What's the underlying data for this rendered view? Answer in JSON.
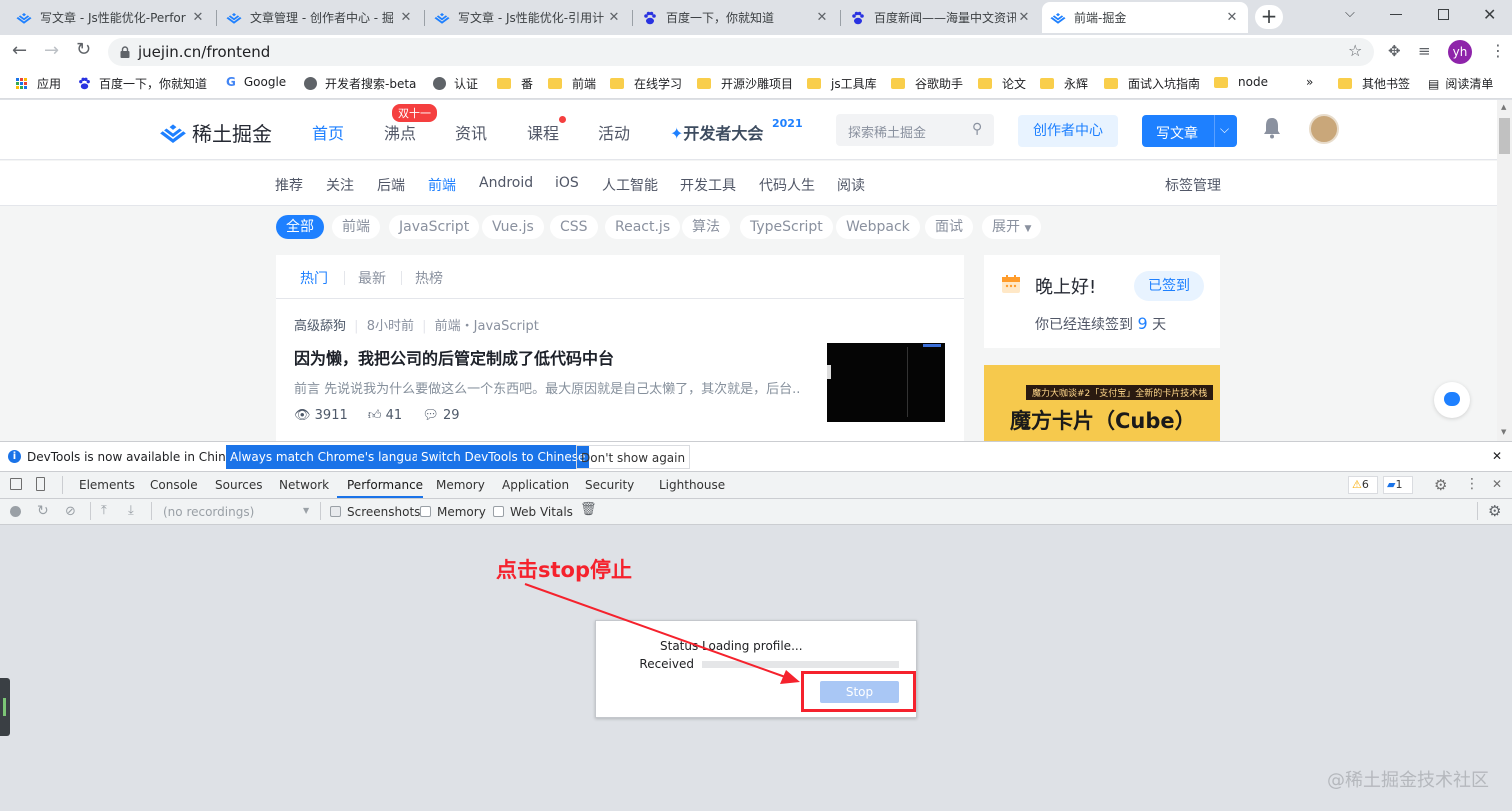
{
  "browser": {
    "tabs": [
      {
        "title": "写文章 - Js性能优化-Perfor",
        "icon": "juejin-logo-icon",
        "active": false
      },
      {
        "title": "文章管理 - 创作者中心 - 掘",
        "icon": "juejin-logo-icon",
        "active": false
      },
      {
        "title": "写文章 - Js性能优化-引用计",
        "icon": "juejin-logo-icon",
        "active": false
      },
      {
        "title": "百度一下，你就知道",
        "icon": "baidu-paw-icon",
        "active": false
      },
      {
        "title": "百度新闻——海量中文资讯",
        "icon": "baidu-paw-icon",
        "active": false
      },
      {
        "title": "前端-掘金",
        "icon": "juejin-logo-icon",
        "active": true
      }
    ],
    "url": "juejin.cn/frontend",
    "profile_initials": "yh",
    "bookmarks": [
      {
        "label": "应用",
        "icon": "apps-grid-icon"
      },
      {
        "label": "百度一下，你就知道",
        "icon": "baidu-paw-icon"
      },
      {
        "label": "Google",
        "icon": "google-g-icon"
      },
      {
        "label": "开发者搜索-beta",
        "icon": "globe-icon"
      },
      {
        "label": "认证",
        "icon": "globe-icon"
      },
      {
        "label": "番",
        "icon": "folder-icon"
      },
      {
        "label": "前端",
        "icon": "folder-icon"
      },
      {
        "label": "在线学习",
        "icon": "folder-icon"
      },
      {
        "label": "开源沙雕项目",
        "icon": "folder-icon"
      },
      {
        "label": "js工具库",
        "icon": "folder-icon"
      },
      {
        "label": "谷歌助手",
        "icon": "folder-icon"
      },
      {
        "label": "论文",
        "icon": "folder-icon"
      },
      {
        "label": "永辉",
        "icon": "folder-icon"
      },
      {
        "label": "面试入坑指南",
        "icon": "folder-icon"
      },
      {
        "label": "node",
        "icon": "folder-icon"
      }
    ],
    "bookmarks_more": "»",
    "other_bookmarks": "其他书签",
    "reading_list": "阅读清单"
  },
  "juejin": {
    "logo_text": "稀土掘金",
    "nav": [
      "首页",
      "沸点",
      "资讯",
      "课程",
      "活动"
    ],
    "nav_badge": "双十一",
    "devcon": "开发者大会",
    "devcon_year": "2021",
    "search_placeholder": "探索稀土掘金",
    "creator_center": "创作者中心",
    "write_article": "写文章",
    "subnav": [
      "推荐",
      "关注",
      "后端",
      "前端",
      "Android",
      "iOS",
      "人工智能",
      "开发工具",
      "代码人生",
      "阅读"
    ],
    "tag_manage": "标签管理",
    "tags": [
      "全部",
      "前端",
      "JavaScript",
      "Vue.js",
      "CSS",
      "React.js",
      "算法",
      "TypeScript",
      "Webpack",
      "面试",
      "展开"
    ],
    "feed_tabs": [
      "热门",
      "最新",
      "热榜"
    ],
    "article": {
      "author": "高级舔狗",
      "time": "8小时前",
      "tags": "前端・JavaScript",
      "title": "因为懒，我把公司的后管定制成了低代码中台",
      "abstract": "前言 先说说我为什么要做这么一个东西吧。最大原因就是自己太懒了，其次就是，后台...",
      "views": "3911",
      "likes": "41",
      "comments": "29"
    },
    "greeting": "晚上好!",
    "signed_in": "已签到",
    "streak_prefix": "你已经连续签到",
    "streak_days": "9",
    "streak_suffix": "天",
    "banner_small": "魔力大咖谈#2「支付宝」全新的卡片技术栈",
    "banner_title": "魔方卡片（Cube）"
  },
  "infobar": {
    "message": "DevTools is now available in Chinese!",
    "btn_match": "Always match Chrome's language",
    "btn_switch": "Switch DevTools to Chinese",
    "btn_dont": "Don't show again"
  },
  "devtools": {
    "tabs": [
      "Elements",
      "Console",
      "Sources",
      "Network",
      "Performance",
      "Memory",
      "Application",
      "Security",
      "Lighthouse"
    ],
    "active_tab": "Performance",
    "warnings": "6",
    "messages": "1",
    "recordings": "(no recordings)",
    "opt_screenshots": "Screenshots",
    "opt_memory": "Memory",
    "opt_webvitals": "Web Vitals",
    "status_label": "Status",
    "status_value": "Loading profile...",
    "received_label": "Received",
    "stop_label": "Stop"
  },
  "annotation": {
    "text": "点击stop停止",
    "color": "#f5222d"
  },
  "watermark": "@稀土掘金技术社区",
  "colors": {
    "juejin_blue": "#1e80ff",
    "devtools_blue": "#1a73e8"
  }
}
